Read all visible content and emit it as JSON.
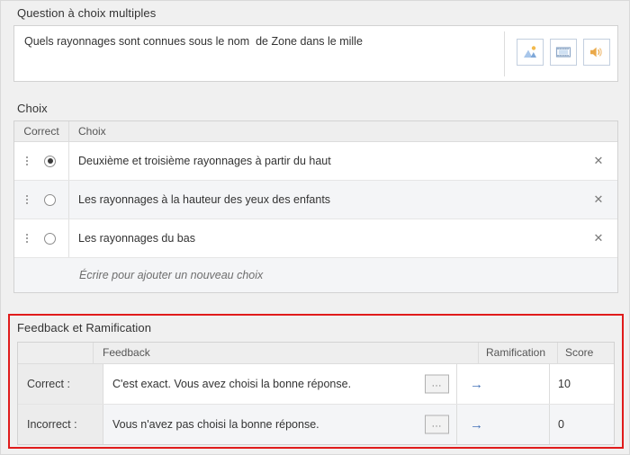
{
  "question": {
    "title": "Question à choix multiples",
    "text": "Quels rayonnages sont connues sous le nom  de Zone dans le mille",
    "media_buttons": [
      {
        "name": "image-icon",
        "label": "Image"
      },
      {
        "name": "video-icon",
        "label": "Vidéo"
      },
      {
        "name": "audio-icon",
        "label": "Audio"
      }
    ]
  },
  "choices": {
    "title": "Choix",
    "columns": [
      "Correct",
      "Choix"
    ],
    "rows": [
      {
        "correct": true,
        "text": "Deuxième et troisième rayonnages à partir du haut",
        "remove": "✕"
      },
      {
        "correct": false,
        "text": "Les rayonnages à la hauteur des yeux des enfants",
        "remove": "✕"
      },
      {
        "correct": false,
        "text": "Les rayonnages du bas",
        "remove": "✕"
      }
    ],
    "add_placeholder": "Écrire pour ajouter un nouveau choix"
  },
  "feedback": {
    "title": "Feedback et Ramification",
    "columns": [
      "",
      "Feedback",
      "Ramification",
      "Score"
    ],
    "rows": [
      {
        "label": "Correct :",
        "text": "C'est exact. Vous avez choisi la bonne réponse.",
        "ellipsis": "...",
        "branch": "→",
        "score": "10"
      },
      {
        "label": "Incorrect :",
        "text": "Vous n'avez pas choisi la bonne réponse.",
        "ellipsis": "...",
        "branch": "→",
        "score": "0"
      }
    ]
  },
  "colors": {
    "highlight_border": "#e01b1b",
    "accent_blue": "#4472b8",
    "page_background": "#f0f0f0",
    "panel_background": "#ffffff",
    "header_background": "#eeeeee"
  }
}
